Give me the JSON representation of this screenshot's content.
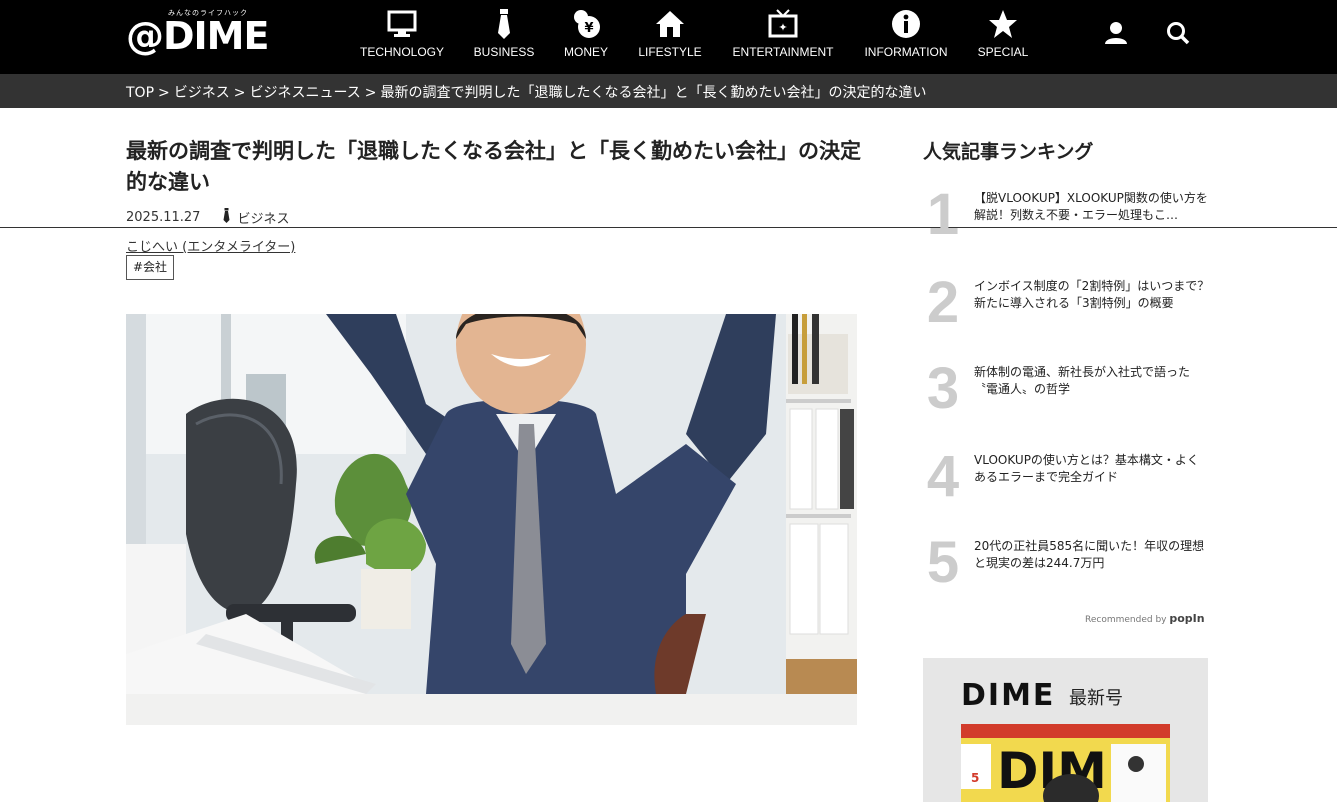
{
  "header": {
    "logo_tagline": "みんなのライフハック",
    "logo_text": "@DIME",
    "nav": [
      {
        "label": "TECHNOLOGY",
        "icon": "monitor-icon"
      },
      {
        "label": "BUSINESS",
        "icon": "necktie-icon"
      },
      {
        "label": "MONEY",
        "icon": "money-bag-icon"
      },
      {
        "label": "LIFESTYLE",
        "icon": "house-icon"
      },
      {
        "label": "ENTERTAINMENT",
        "icon": "tv-icon"
      },
      {
        "label": "INFORMATION",
        "icon": "info-icon"
      },
      {
        "label": "SPECIAL",
        "icon": "star-icon"
      }
    ],
    "user_icon": "user-icon",
    "search_icon": "search-icon"
  },
  "breadcrumb": {
    "items": [
      "TOP",
      "ビジネス",
      "ビジネスニュース",
      "最新の調査で判明した「退職したくなる会社」と「長く勤めたい会社」の決定的な違い"
    ],
    "separator": ">"
  },
  "article": {
    "title": "最新の調査で判明した「退職したくなる会社」と「長く勤めたい会社」の決定的な違い",
    "date": "2025.11.27",
    "category": "ビジネス",
    "author": "こじへい (エンタメライター)",
    "tag": "#会社"
  },
  "sidebar": {
    "ranking_title": "人気記事ランキング",
    "ranking": [
      {
        "rank": "1",
        "text": "【脱VLOOKUP】XLOOKUP関数の使い方を解説！列数え不要・エラー処理もこ…"
      },
      {
        "rank": "2",
        "text": "インボイス制度の「2割特例」はいつまで？新たに導入される「3割特例」の概要"
      },
      {
        "rank": "3",
        "text": "新体制の電通、新社長が入社式で語った〝電通人〟の哲学"
      },
      {
        "rank": "4",
        "text": "VLOOKUPの使い方とは？基本構文・よくあるエラーまで完全ガイド"
      },
      {
        "rank": "5",
        "text": "20代の正社員585名に聞いた！年収の理想と現実の差は244.7万円"
      }
    ],
    "recommended_by": "Recommended by",
    "popin_logo": "popIn",
    "magazine_brand": "DIME",
    "magazine_latest": "最新号",
    "cover_text": "DIME",
    "cover_issue": "5"
  },
  "colors": {
    "header_bg": "#000000",
    "breadcrumb_bg": "#333333",
    "rank_number": "#cccccc"
  }
}
